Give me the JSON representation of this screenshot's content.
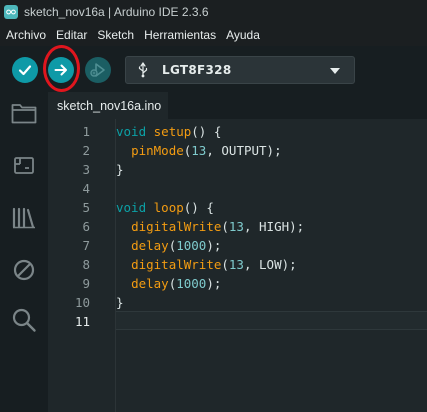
{
  "window": {
    "title": "sketch_nov16a | Arduino IDE 2.3.6"
  },
  "menu": [
    "Archivo",
    "Editar",
    "Sketch",
    "Herramientas",
    "Ayuda"
  ],
  "toolbar": {
    "verify_icon": "check-icon",
    "upload_icon": "arrow-right-icon",
    "debug_icon": "debug-icon",
    "board": "LGT8F328",
    "upload_highlighted": true,
    "colors": {
      "accent": "#0e9aa7",
      "highlight": "#e0161e"
    }
  },
  "sidebar": {
    "items": [
      "folder-icon",
      "board-manager-icon",
      "library-icon",
      "debug-disabled-icon",
      "search-icon"
    ]
  },
  "tab": {
    "filename": "sketch_nov16a.ino"
  },
  "editor": {
    "active_line": "11",
    "lines": [
      {
        "num": "1",
        "parts": [
          {
            "t": "kw",
            "v": "void"
          },
          {
            "t": "pl",
            "v": " "
          },
          {
            "t": "fn",
            "v": "setup"
          },
          {
            "t": "pl",
            "v": "() {"
          }
        ]
      },
      {
        "num": "2",
        "parts": [
          {
            "t": "pl",
            "v": "  "
          },
          {
            "t": "fn",
            "v": "pinMode"
          },
          {
            "t": "pl",
            "v": "("
          },
          {
            "t": "num",
            "v": "13"
          },
          {
            "t": "pl",
            "v": ", OUTPUT);"
          }
        ]
      },
      {
        "num": "3",
        "parts": [
          {
            "t": "pl",
            "v": "}"
          }
        ]
      },
      {
        "num": "4",
        "parts": []
      },
      {
        "num": "5",
        "parts": [
          {
            "t": "kw",
            "v": "void"
          },
          {
            "t": "pl",
            "v": " "
          },
          {
            "t": "fn",
            "v": "loop"
          },
          {
            "t": "pl",
            "v": "() {"
          }
        ]
      },
      {
        "num": "6",
        "parts": [
          {
            "t": "pl",
            "v": "  "
          },
          {
            "t": "fn",
            "v": "digitalWrite"
          },
          {
            "t": "pl",
            "v": "("
          },
          {
            "t": "num",
            "v": "13"
          },
          {
            "t": "pl",
            "v": ", HIGH);"
          }
        ]
      },
      {
        "num": "7",
        "parts": [
          {
            "t": "pl",
            "v": "  "
          },
          {
            "t": "fn",
            "v": "delay"
          },
          {
            "t": "pl",
            "v": "("
          },
          {
            "t": "num",
            "v": "1000"
          },
          {
            "t": "pl",
            "v": ");"
          }
        ]
      },
      {
        "num": "8",
        "parts": [
          {
            "t": "pl",
            "v": "  "
          },
          {
            "t": "fn",
            "v": "digitalWrite"
          },
          {
            "t": "pl",
            "v": "("
          },
          {
            "t": "num",
            "v": "13"
          },
          {
            "t": "pl",
            "v": ", LOW);"
          }
        ]
      },
      {
        "num": "9",
        "parts": [
          {
            "t": "pl",
            "v": "  "
          },
          {
            "t": "fn",
            "v": "delay"
          },
          {
            "t": "pl",
            "v": "("
          },
          {
            "t": "num",
            "v": "1000"
          },
          {
            "t": "pl",
            "v": ");"
          }
        ]
      },
      {
        "num": "10",
        "parts": [
          {
            "t": "pl",
            "v": "}"
          }
        ]
      },
      {
        "num": "11",
        "parts": []
      }
    ]
  }
}
